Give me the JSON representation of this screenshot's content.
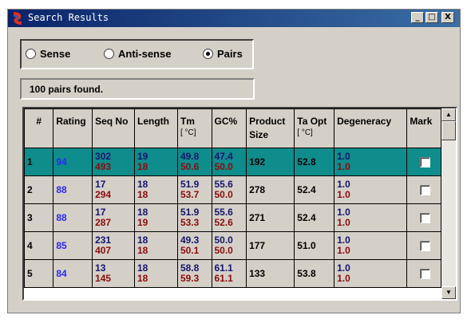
{
  "window": {
    "title": "Search Results",
    "controls": {
      "minimize": "_",
      "maximize": "□",
      "close": "X"
    }
  },
  "strand": {
    "options": [
      "Sense",
      "Anti-sense",
      "Pairs"
    ],
    "selected": "Pairs"
  },
  "status_text": "100 pairs found.",
  "table": {
    "headers": {
      "num": "#",
      "rating": "Rating",
      "seqno": "Seq No",
      "length": "Length",
      "tm": "Tm",
      "tm_unit": "[ °C]",
      "gc": "GC%",
      "product_1": "Product",
      "product_2": "Size",
      "taopt": "Ta Opt",
      "taopt_unit": "[ °C]",
      "degeneracy": "Degeneracy",
      "mark": "Mark"
    },
    "rows": [
      {
        "num": "1",
        "rating": "94",
        "seq": [
          "302",
          "493"
        ],
        "len": [
          "19",
          "18"
        ],
        "tm": [
          "49.8",
          "50.6"
        ],
        "gc": [
          "47.4",
          "50.0"
        ],
        "product": "192",
        "taopt": "52.8",
        "deg": [
          "1.0",
          "1.0"
        ],
        "marked": false,
        "selected": true
      },
      {
        "num": "2",
        "rating": "88",
        "seq": [
          "17",
          "294"
        ],
        "len": [
          "18",
          "18"
        ],
        "tm": [
          "51.9",
          "53.7"
        ],
        "gc": [
          "55.6",
          "50.0"
        ],
        "product": "278",
        "taopt": "52.4",
        "deg": [
          "1.0",
          "1.0"
        ],
        "marked": false,
        "selected": false
      },
      {
        "num": "3",
        "rating": "88",
        "seq": [
          "17",
          "287"
        ],
        "len": [
          "18",
          "19"
        ],
        "tm": [
          "51.9",
          "53.3"
        ],
        "gc": [
          "55.6",
          "52.6"
        ],
        "product": "271",
        "taopt": "52.4",
        "deg": [
          "1.0",
          "1.0"
        ],
        "marked": false,
        "selected": false
      },
      {
        "num": "4",
        "rating": "85",
        "seq": [
          "231",
          "407"
        ],
        "len": [
          "18",
          "18"
        ],
        "tm": [
          "49.3",
          "50.1"
        ],
        "gc": [
          "50.0",
          "50.0"
        ],
        "product": "177",
        "taopt": "51.0",
        "deg": [
          "1.0",
          "1.0"
        ],
        "marked": false,
        "selected": false
      },
      {
        "num": "5",
        "rating": "84",
        "seq": [
          "13",
          "145"
        ],
        "len": [
          "18",
          "18"
        ],
        "tm": [
          "58.8",
          "59.3"
        ],
        "gc": [
          "61.1",
          "61.1"
        ],
        "product": "133",
        "taopt": "53.8",
        "deg": [
          "1.0",
          "1.0"
        ],
        "marked": false,
        "selected": false
      }
    ]
  },
  "scrollbar": {
    "up": "▲",
    "down": "▼"
  },
  "colors": {
    "titlebar": "#0a246a",
    "selected_row": "#0f8c8c",
    "forward_primer": "#14146e",
    "reverse_primer": "#8b0c0c",
    "rating": "#2a2af0"
  }
}
